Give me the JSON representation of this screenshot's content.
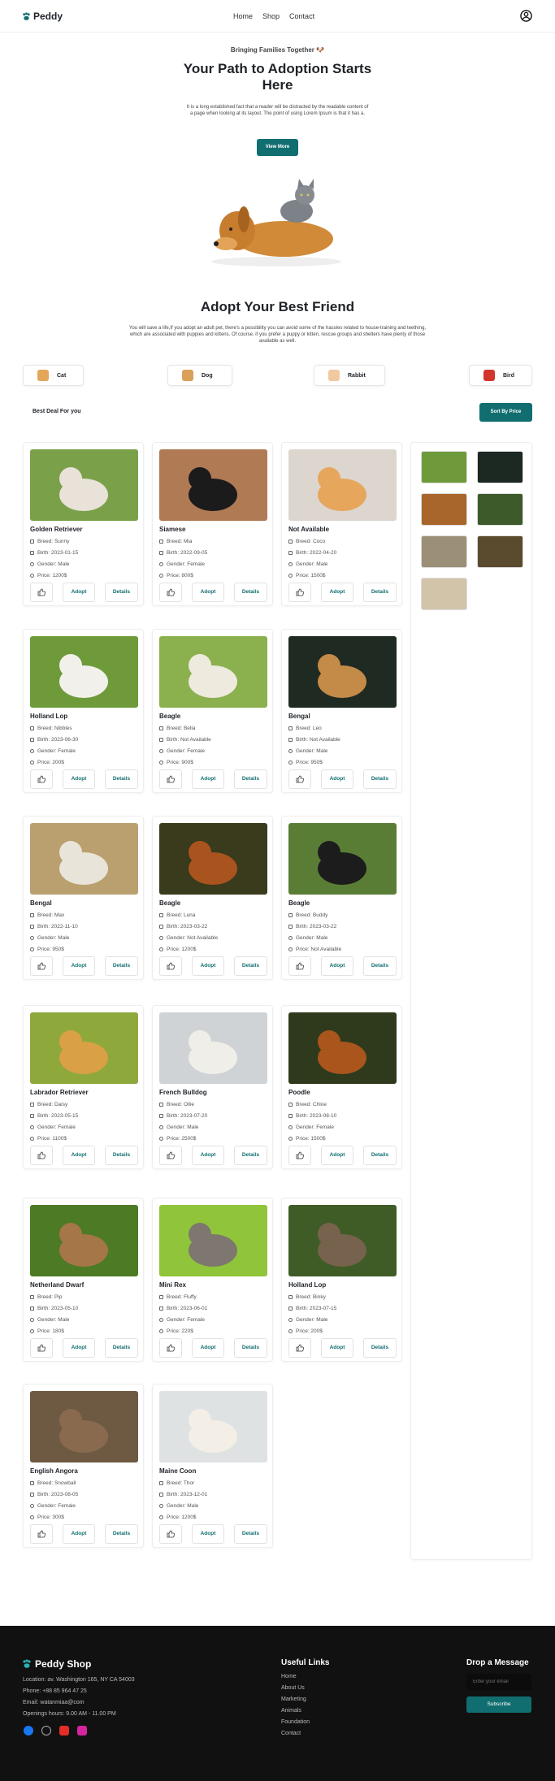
{
  "brand": {
    "name": "Peddy",
    "accent": "#116e70"
  },
  "nav": {
    "links": [
      "Home",
      "Shop",
      "Contact"
    ]
  },
  "hero": {
    "kicker": "Bringing Families Together 🐶",
    "title": "Your Path to Adoption Starts Here",
    "description": "It is a long established fact that a reader will be distracted by the readable content of a page when looking at its layout. The point of using Lorem Ipsum is that it has a.",
    "button": "View More"
  },
  "adopt": {
    "title": "Adopt Your Best Friend",
    "description": "You will save a life,If you adopt an adult pet, there's a possibility you can avoid some of the hassles related to house-training and teething, which are associated with puppies and kittens. Of course, if you prefer a puppy or kitten, rescue groups and shelters have plenty of those available as well."
  },
  "categories": [
    "Cat",
    "Dog",
    "Rabbit",
    "Bird"
  ],
  "best_deal_label": "Best Deal For you",
  "sort_button": "Sort By Price",
  "card_buttons": {
    "adopt": "Adopt",
    "details": "Details"
  },
  "pets": [
    {
      "name": "Golden Retriever",
      "breed": "Breed: Sunny",
      "birth": "Birth: 2023-01-15",
      "gender": "Gender: Male",
      "price": "Price: 1200$"
    },
    {
      "name": "Siamese",
      "breed": "Breed: Mia",
      "birth": "Birth: 2022-09-05",
      "gender": "Gender: Female",
      "price": "Price: 800$"
    },
    {
      "name": "Not Available",
      "breed": "Breed: Coco",
      "birth": "Birth: 2022-04-20",
      "gender": "Gender: Male",
      "price": "Price: 1500$"
    },
    {
      "name": "Holland Lop",
      "breed": "Breed: Nibbles",
      "birth": "Birth: 2023-06-30",
      "gender": "Gender: Female",
      "price": "Price: 200$"
    },
    {
      "name": "Beagle",
      "breed": "Breed: Bella",
      "birth": "Birth: Not Available",
      "gender": "Gender: Female",
      "price": "Price: 900$"
    },
    {
      "name": "Bengal",
      "breed": "Breed: Leo",
      "birth": "Birth: Not Available",
      "gender": "Gender: Male",
      "price": "Price: 950$"
    },
    {
      "name": "Bengal",
      "breed": "Breed: Max",
      "birth": "Birth: 2022-11-10",
      "gender": "Gender: Male",
      "price": "Price: 950$"
    },
    {
      "name": "Beagle",
      "breed": "Breed: Luna",
      "birth": "Birth: 2023-03-22",
      "gender": "Gender: Not Available",
      "price": "Price: 1200$"
    },
    {
      "name": "Beagle",
      "breed": "Breed: Buddy",
      "birth": "Birth: 2023-03-22",
      "gender": "Gender: Male",
      "price": "Price: Not Available"
    },
    {
      "name": "Labrador Retriever",
      "breed": "Breed: Daisy",
      "birth": "Birth: 2023-05-15",
      "gender": "Gender: Female",
      "price": "Price: 1100$"
    },
    {
      "name": "French Bulldog",
      "breed": "Breed: Ollie",
      "birth": "Birth: 2023-07-20",
      "gender": "Gender: Male",
      "price": "Price: 2500$"
    },
    {
      "name": "Poodle",
      "breed": "Breed: Chloe",
      "birth": "Birth: 2023-08-10",
      "gender": "Gender: Female",
      "price": "Price: 1500$"
    },
    {
      "name": "Netherland Dwarf",
      "breed": "Breed: Pip",
      "birth": "Birth: 2023-05-10",
      "gender": "Gender: Male",
      "price": "Price: 180$"
    },
    {
      "name": "Mini Rex",
      "breed": "Breed: Fluffy",
      "birth": "Birth: 2023-06-01",
      "gender": "Gender: Female",
      "price": "Price: 220$"
    },
    {
      "name": "Holland Lop",
      "breed": "Breed: Binky",
      "birth": "Birth: 2023-07-15",
      "gender": "Gender: Male",
      "price": "Price: 200$"
    },
    {
      "name": "English Angora",
      "breed": "Breed: Snowball",
      "birth": "Birth: 2023-08-05",
      "gender": "Gender: Female",
      "price": "Price: 300$"
    },
    {
      "name": "Maine Coon",
      "breed": "Breed: Thor",
      "birth": "Birth: 2023-12-01",
      "gender": "Gender: Male",
      "price": "Price: 1200$"
    }
  ],
  "footer": {
    "brand": "Peddy Shop",
    "location": "Location: av. Washington 165, NY CA 54003",
    "phone": "Phone: +88 85 964 47 25",
    "email": "Email: watanmiaa@com",
    "hours": "Openings hours: 9.00 AM - 11.00 PM",
    "useful_title": "Useful Links",
    "useful_links": [
      "Home",
      "About Us",
      "Marketing",
      "Animals",
      "Foundation",
      "Contact"
    ],
    "drop_title": "Drop a Message",
    "email_placeholder": "Enter your email",
    "subscribe": "Subscribe"
  }
}
